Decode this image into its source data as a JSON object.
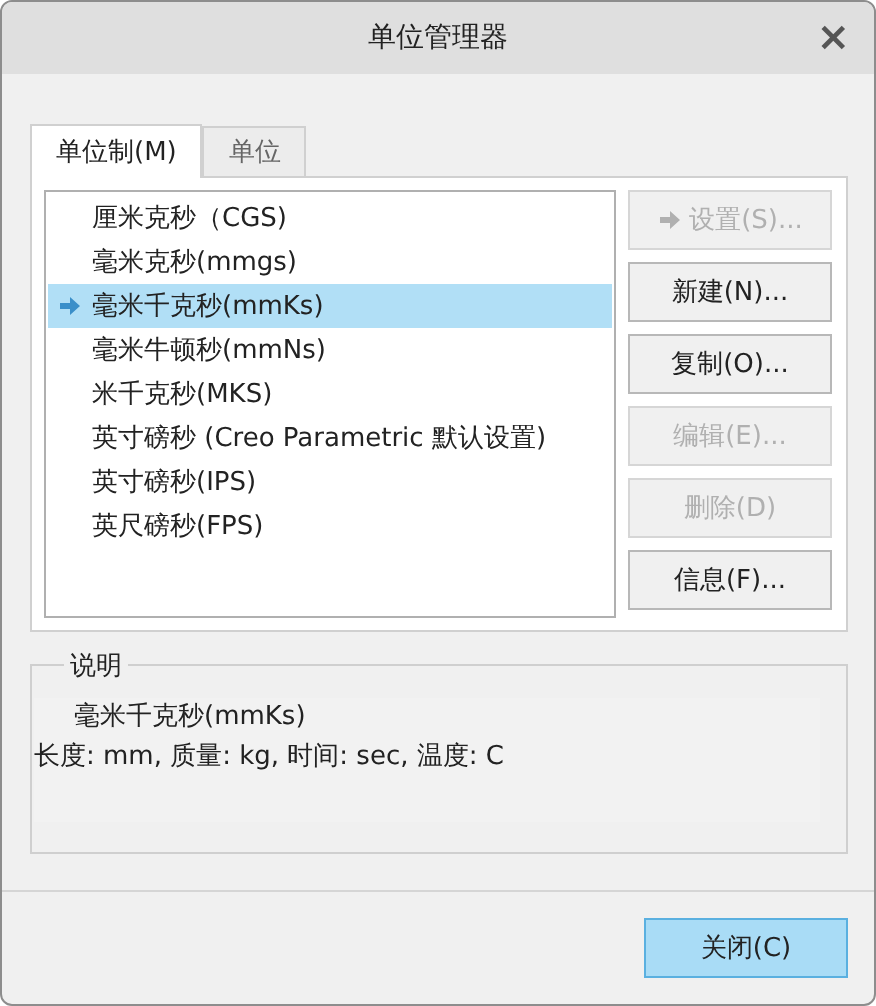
{
  "window": {
    "title": "单位管理器",
    "close": "×"
  },
  "tabs": [
    {
      "label": "单位制(M)",
      "selected": true
    },
    {
      "label": "单位",
      "selected": false
    }
  ],
  "unit_systems": [
    {
      "label": "厘米克秒（CGS)",
      "selected": false,
      "current": false
    },
    {
      "label": "毫米克秒(mmgs)",
      "selected": false,
      "current": false
    },
    {
      "label": "毫米千克秒(mmKs)",
      "selected": true,
      "current": true
    },
    {
      "label": "毫米牛顿秒(mmNs)",
      "selected": false,
      "current": false
    },
    {
      "label": "米千克秒(MKS)",
      "selected": false,
      "current": false
    },
    {
      "label": "英寸磅秒 (Creo Parametric 默认设置)",
      "selected": false,
      "current": false
    },
    {
      "label": "英寸磅秒(IPS)",
      "selected": false,
      "current": false
    },
    {
      "label": "英尺磅秒(FPS)",
      "selected": false,
      "current": false
    }
  ],
  "actions": [
    {
      "label": "设置(S)...",
      "kind": "arrow",
      "disabled": true
    },
    {
      "label": "新建(N)...",
      "kind": "plain",
      "disabled": false
    },
    {
      "label": "复制(O)...",
      "kind": "plain",
      "disabled": false
    },
    {
      "label": "编辑(E)...",
      "kind": "plain",
      "disabled": true
    },
    {
      "label": "删除(D)",
      "kind": "plain",
      "disabled": true
    },
    {
      "label": "信息(F)...",
      "kind": "plain",
      "disabled": false
    }
  ],
  "description": {
    "title": "说明",
    "name": "毫米千克秒(mmKs)",
    "details": "长度: mm, 质量: kg, 时间: sec, 温度: C"
  },
  "close_button": "关闭(C)"
}
